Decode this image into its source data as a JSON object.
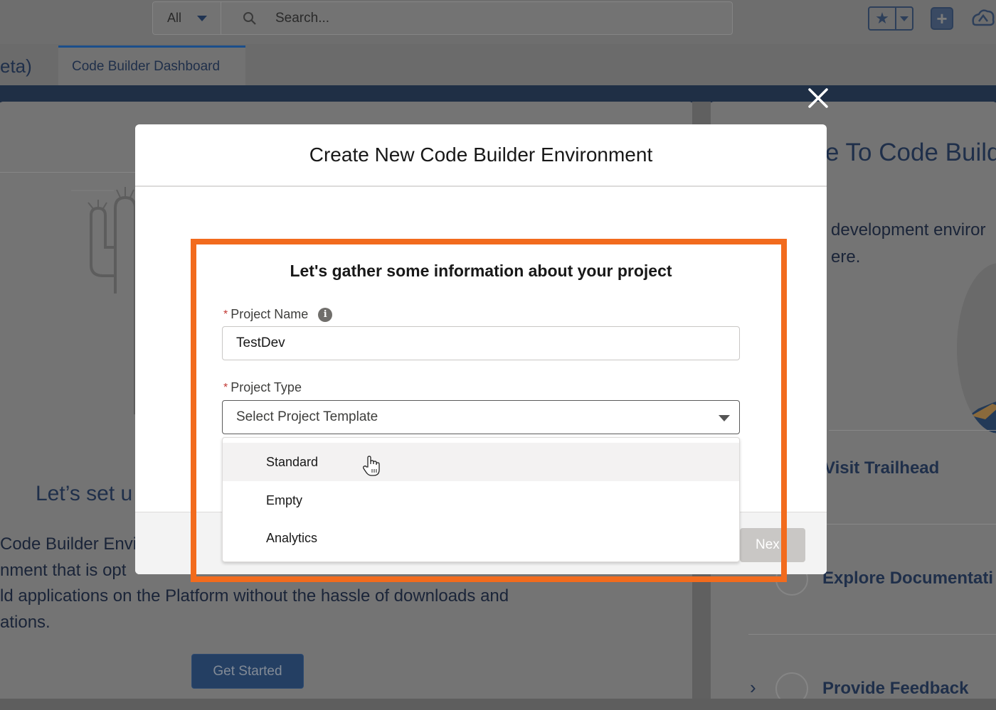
{
  "header": {
    "search_scope": "All",
    "search_placeholder": "Search...",
    "icons": [
      "search-icon",
      "star-icon",
      "chevron-down-icon",
      "plus-icon",
      "cloud-icon"
    ]
  },
  "nav": {
    "app_name_partial": "eta)",
    "active_tab": "Code Builder Dashboard"
  },
  "background": {
    "left_card": {
      "title_partial": "Let’s set u",
      "body_lines": [
        "Code Builder Envi",
        "nment that is opt",
        "ld applications on the Platform without the hassle of downloads and",
        "ations."
      ],
      "button_label": "Get Started"
    },
    "right_card": {
      "title_partial": "e To Code Builde",
      "body_lines": [
        "development enviror",
        "ere."
      ],
      "links": [
        "Visit Trailhead",
        "Explore Documentati",
        "Provide Feedback"
      ]
    }
  },
  "modal": {
    "title": "Create New Code Builder Environment",
    "form_title": "Let's gather some information about your project",
    "required_marker": "*",
    "project_name": {
      "label": "Project Name",
      "value": "TestDev",
      "info_icon_glyph": "i"
    },
    "project_type": {
      "label": "Project Type",
      "placeholder": "Select Project Template",
      "options": [
        "Standard",
        "Empty",
        "Analytics"
      ],
      "hovered_option": "Standard"
    },
    "next_label_partial": "Nex"
  },
  "colors": {
    "highlight": "#f26b1d",
    "navy": "#1f2f45",
    "required": "#c23934"
  }
}
